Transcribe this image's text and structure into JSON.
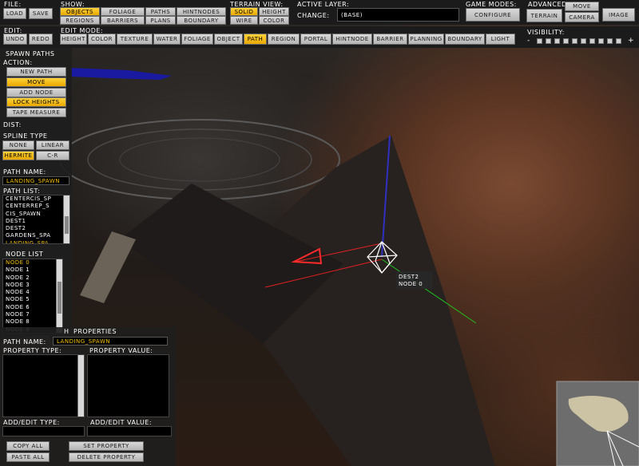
{
  "top": {
    "file_label": "File:",
    "load": "Load",
    "save": "Save",
    "show_label": "Show:",
    "show": {
      "objects": "Objects",
      "regions": "Regions",
      "foliage": "Foliage",
      "barriers": "Barriers",
      "paths": "Paths",
      "plans": "Plans",
      "hintnodes": "HintNodes",
      "boundary": "Boundary"
    },
    "terrain_view_label": "Terrain View:",
    "solid": "Solid",
    "height": "Height",
    "wire": "Wire",
    "color": "Color",
    "active_layer_label": "Active Layer:",
    "change_label": "Change:",
    "active_layer_value": "(Base)",
    "game_modes_label": "Game Modes:",
    "configure": "Configure",
    "advanced_label": "Advanced",
    "terrain": "Terrain",
    "move": "Move",
    "camera": "Camera",
    "image": "Image"
  },
  "second": {
    "edit_label": "Edit:",
    "undo": "Undo",
    "redo": "Redo",
    "edit_mode_label": "Edit Mode:",
    "modes": [
      "Height",
      "Color",
      "Texture",
      "Water",
      "Foliage",
      "Object",
      "Path",
      "Region",
      "Portal",
      "HintNode",
      "Barrier",
      "Planning",
      "Boundary",
      "Light"
    ],
    "active_mode": "Path",
    "visibility_label": "Visibility:",
    "vis_minus": "-",
    "vis_plus": "+",
    "visibility_level": "0 of 10"
  },
  "left": {
    "title": "Spawn Paths",
    "action_label": "Action:",
    "new_path": "New Path",
    "move": "Move",
    "add_node": "Add Node",
    "lock_heights": "Lock Heights",
    "tape_measure": "Tape Measure",
    "dist_label": "Dist:",
    "spline_type_label": "Spline Type",
    "none": "None",
    "linear": "Linear",
    "hermite": "Hermite",
    "cr": "C-R",
    "path_name_label": "Path Name:",
    "path_name_value": "LANDING_SPAWN",
    "path_list_label": "Path List:",
    "path_list": [
      "CENTERCIS_SP",
      "CENTERREP_S",
      "CIS_SPAWN",
      "DEST1",
      "DEST2",
      "GARDENS_SPA",
      "LANDING_SPA"
    ],
    "node_list_label": "Node List",
    "node_list": [
      "Node 0",
      "Node 1",
      "Node 2",
      "Node 3",
      "Node 4",
      "Node 5",
      "Node 6",
      "Node 7",
      "Node 8",
      "Node 9"
    ]
  },
  "props": {
    "title_prefix": "H",
    "title": "Properties",
    "path_name_label": "Path Name:",
    "path_name_value": "LANDING_SPAWN",
    "property_type_label": "Property Type:",
    "property_value_label": "Property Value:",
    "add_edit_type_label": "Add/Edit Type:",
    "add_edit_value_label": "Add/Edit Value:",
    "copy_all": "Copy All",
    "paste_all": "Paste All",
    "set_property": "Set Property",
    "delete_property": "Delete Property"
  },
  "viewport": {
    "tooltip_line1": "DEST2",
    "tooltip_line2": "Node 0"
  },
  "colors": {
    "accent": "#f5c000",
    "axis_x": "#ff2020",
    "axis_y": "#20c020",
    "axis_z": "#2020ff"
  }
}
